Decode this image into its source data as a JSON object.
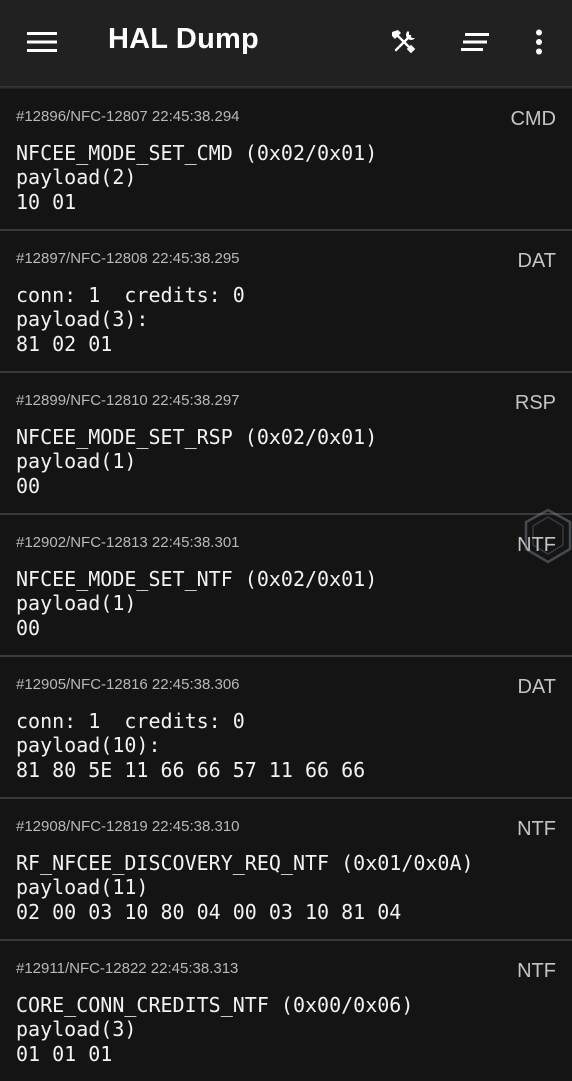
{
  "app_bar": {
    "title": "HAL Dump",
    "menu_icon": "hamburger-menu-icon",
    "actions": [
      {
        "name": "tools",
        "icon": "hammer-wrench-icon"
      },
      {
        "name": "sort",
        "icon": "sort-lines-icon"
      },
      {
        "name": "more",
        "icon": "more-vertical-icon"
      }
    ]
  },
  "entries": [
    {
      "meta": "#12896/NFC-12807 22:45:38.294",
      "type": "CMD",
      "line1": "NFCEE_MODE_SET_CMD (0x02/0x01)",
      "line2": "payload(2)",
      "line3": "10 01"
    },
    {
      "meta": "#12897/NFC-12808 22:45:38.295",
      "type": "DAT",
      "line1": "conn: 1  credits: 0",
      "line2": "payload(3):",
      "line3": "81 02 01"
    },
    {
      "meta": "#12899/NFC-12810 22:45:38.297",
      "type": "RSP",
      "line1": "NFCEE_MODE_SET_RSP (0x02/0x01)",
      "line2": "payload(1)",
      "line3": "00"
    },
    {
      "meta": "#12902/NFC-12813 22:45:38.301",
      "type": "NTF",
      "line1": "NFCEE_MODE_SET_NTF (0x02/0x01)",
      "line2": "payload(1)",
      "line3": "00"
    },
    {
      "meta": "#12905/NFC-12816 22:45:38.306",
      "type": "DAT",
      "line1": "conn: 1  credits: 0",
      "line2": "payload(10):",
      "line3": "81 80 5E 11 66 66 57 11 66 66"
    },
    {
      "meta": "#12908/NFC-12819 22:45:38.310",
      "type": "NTF",
      "line1": "RF_NFCEE_DISCOVERY_REQ_NTF (0x01/0x0A)",
      "line2": "payload(11)",
      "line3": "02 00 03 10 80 04 00 03 10 81 04"
    },
    {
      "meta": "#12911/NFC-12822 22:45:38.313",
      "type": "NTF",
      "line1": "CORE_CONN_CREDITS_NTF (0x00/0x06)",
      "line2": "payload(3)",
      "line3": "01 01 01"
    }
  ],
  "overlay": {
    "icon": "hexagon-cube-icon"
  },
  "colors": {
    "background": "#141414",
    "app_bar": "#212121",
    "divider": "#3a3a3a",
    "meta_text": "#b8b8b8",
    "body_text": "#f2f2f2"
  }
}
